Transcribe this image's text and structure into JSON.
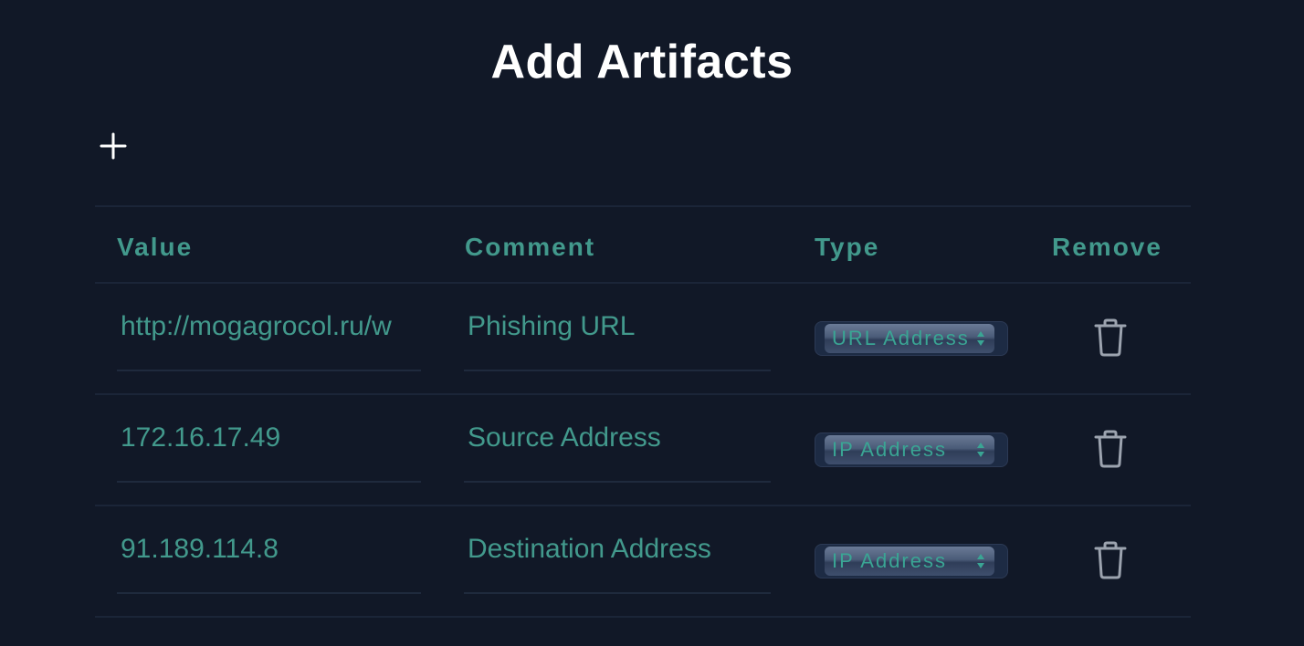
{
  "page": {
    "title": "Add Artifacts"
  },
  "toolbar": {
    "add_icon": "plus-icon"
  },
  "table": {
    "headers": {
      "value": "Value",
      "comment": "Comment",
      "type": "Type",
      "remove": "Remove"
    },
    "rows": [
      {
        "value": "http://mogagrocol.ru/w",
        "comment": "Phishing URL",
        "type": "URL Address",
        "remove_icon": "trash-icon"
      },
      {
        "value": "172.16.17.49",
        "comment": "Source Address",
        "type": "IP Address",
        "remove_icon": "trash-icon"
      },
      {
        "value": "91.189.114.8",
        "comment": "Destination Address",
        "type": "IP Address",
        "remove_icon": "trash-icon"
      }
    ]
  },
  "colors": {
    "background": "#111827",
    "accent": "#42998c",
    "title": "#ffffff",
    "icon": "#9ca3af"
  }
}
